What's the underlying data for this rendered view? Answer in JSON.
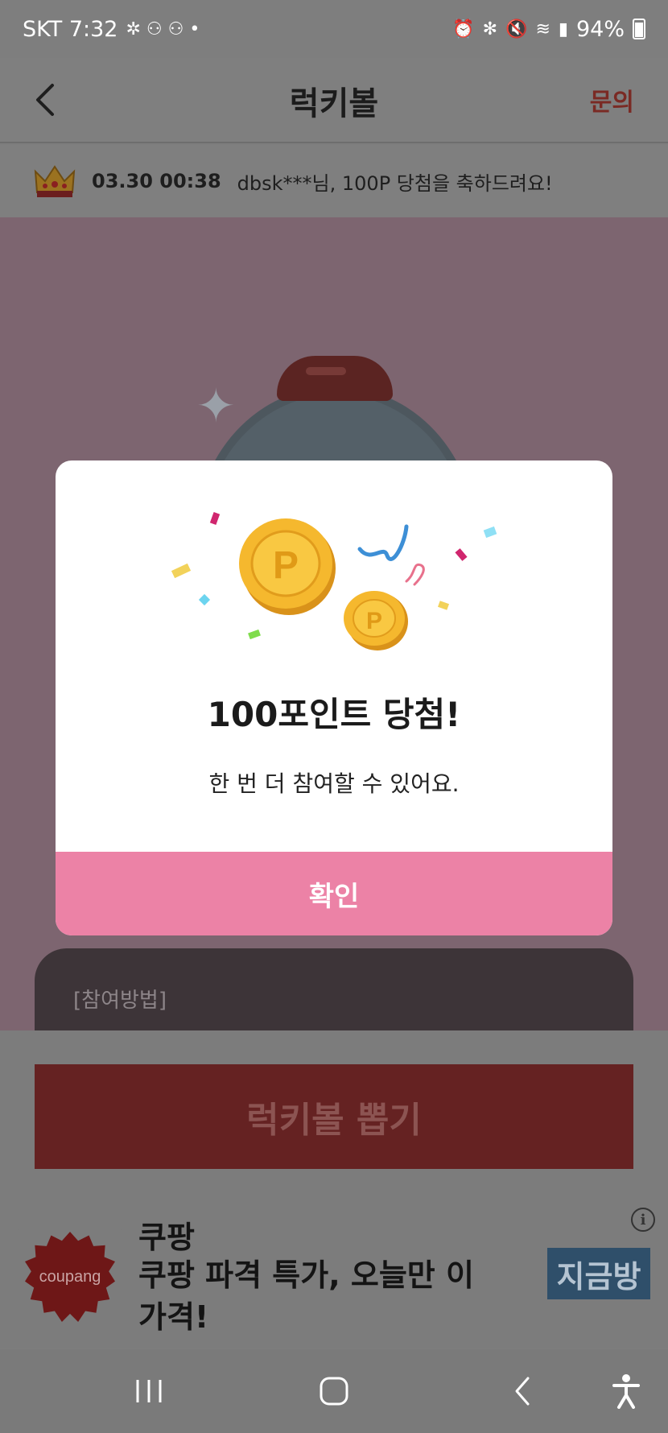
{
  "status_bar": {
    "carrier_time": "SKT 7:32",
    "battery": "94%"
  },
  "header": {
    "title": "럭키볼",
    "inquiry_label": "문의"
  },
  "ticker": {
    "time": "03.30 00:38",
    "message": "dbsk***님, 100P 당첨을 축하드려요!"
  },
  "howto": {
    "label": "[참여방법]"
  },
  "draw_button": {
    "label": "럭키볼 뽑기"
  },
  "ad": {
    "logo_text": "coupang",
    "title": "쿠팡",
    "description": "쿠팡 파격 특가, 오늘만 이 가격!",
    "cta": "지금방"
  },
  "modal": {
    "title": "100포인트 당첨!",
    "subtitle": "한 번 더 참여할 수 있어요.",
    "confirm_label": "확인"
  },
  "colors": {
    "accent_pink": "#ec82a6",
    "inquiry_red": "#7a2a24",
    "coin_gold": "#f5b82e"
  }
}
